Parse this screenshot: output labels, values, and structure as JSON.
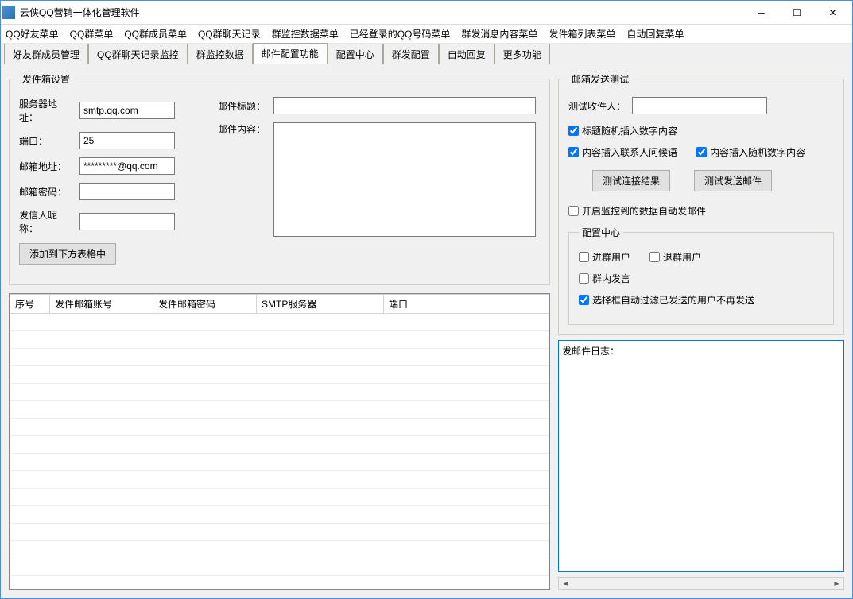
{
  "window": {
    "title": "云侠QQ营销一体化管理软件"
  },
  "menubar": [
    "QQ好友菜单",
    "QQ群菜单",
    "QQ群成员菜单",
    "QQ群聊天记录",
    "群监控数据菜单",
    "已经登录的QQ号码菜单",
    "群发消息内容菜单",
    "发件箱列表菜单",
    "自动回复菜单"
  ],
  "tabs": [
    "好友群成员管理",
    "QQ群聊天记录监控",
    "群监控数据",
    "邮件配置功能",
    "配置中心",
    "群发配置",
    "自动回复",
    "更多功能"
  ],
  "active_tab": 3,
  "sender_settings": {
    "legend": "发件箱设置",
    "server_label": "服务器地址：",
    "server_value": "smtp.qq.com",
    "port_label": "端口：",
    "port_value": "25",
    "email_label": "邮箱地址：",
    "email_value": "*********@qq.com",
    "password_label": "邮箱密码：",
    "password_value": "",
    "nick_label": "发信人昵称：",
    "nick_value": "",
    "subject_label": "邮件标题：",
    "subject_value": "",
    "body_label": "邮件内容：",
    "body_value": "",
    "add_button": "添加到下方表格中"
  },
  "table": {
    "headers": [
      "序号",
      "发件邮箱账号",
      "发件邮箱密码",
      "SMTP服务器",
      "端口"
    ],
    "rows": []
  },
  "test": {
    "legend": "邮箱发送测试",
    "recipient_label": "测试收件人：",
    "recipient_value": "",
    "chk_random_subject": "标题随机插入数字内容",
    "chk_insert_greeting": "内容插入联系人问候语",
    "chk_insert_random": "内容插入随机数字内容",
    "btn_test_conn": "测试连接结果",
    "btn_test_send": "测试发送邮件",
    "chk_auto_send": "开启监控到的数据自动发邮件",
    "chk_random_subject_on": true,
    "chk_insert_greeting_on": true,
    "chk_insert_random_on": true,
    "chk_auto_send_on": false
  },
  "config": {
    "legend": "配置中心",
    "chk_join_user": "进群用户",
    "chk_leave_user": "退群用户",
    "chk_group_speak": "群内发言",
    "chk_filter": "选择框自动过滤已发送的用户不再发送",
    "chk_join_user_on": false,
    "chk_leave_user_on": false,
    "chk_group_speak_on": false,
    "chk_filter_on": true
  },
  "log": {
    "label": "发邮件日志：",
    "content": ""
  }
}
